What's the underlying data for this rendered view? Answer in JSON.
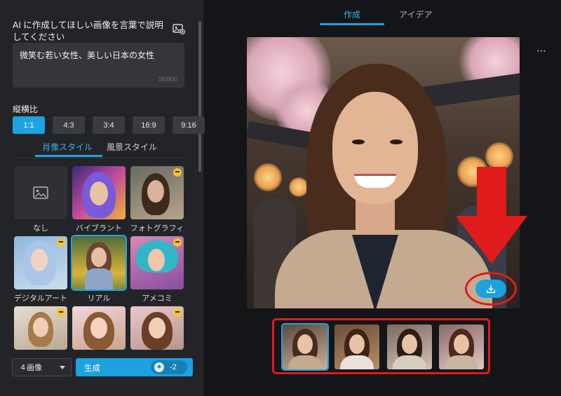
{
  "left_panel": {
    "prompt_title": "AI に作成してほしい画像を言葉で説明してください",
    "prompt_value": "微笑む若い女性、美しい日本の女性",
    "char_count": "16/800",
    "ratio_label": "縦横比",
    "ratios": [
      "1:1",
      "4:3",
      "3:4",
      "16:9",
      "9:16"
    ],
    "selected_ratio": "1:1",
    "style_tabs": [
      "肖像スタイル",
      "風景スタイル"
    ],
    "active_style_tab": "肖像スタイル",
    "styles": [
      {
        "label": "なし"
      },
      {
        "label": "バイブラント"
      },
      {
        "label": "フォトグラフィ"
      },
      {
        "label": "デジタルアート"
      },
      {
        "label": "リアル"
      },
      {
        "label": "アメコミ"
      }
    ],
    "selected_style": "リアル",
    "image_count": "４画像",
    "generate_label": "生成",
    "credit_cost": "-2"
  },
  "top_tabs": [
    "作成",
    "アイデア"
  ],
  "active_top_tab": "作成",
  "more_icon": "⋯",
  "colors": {
    "accent": "#1fa2e0",
    "annotation_red": "#e01b1b",
    "panel_bg": "#232428",
    "page_bg": "#141518"
  }
}
